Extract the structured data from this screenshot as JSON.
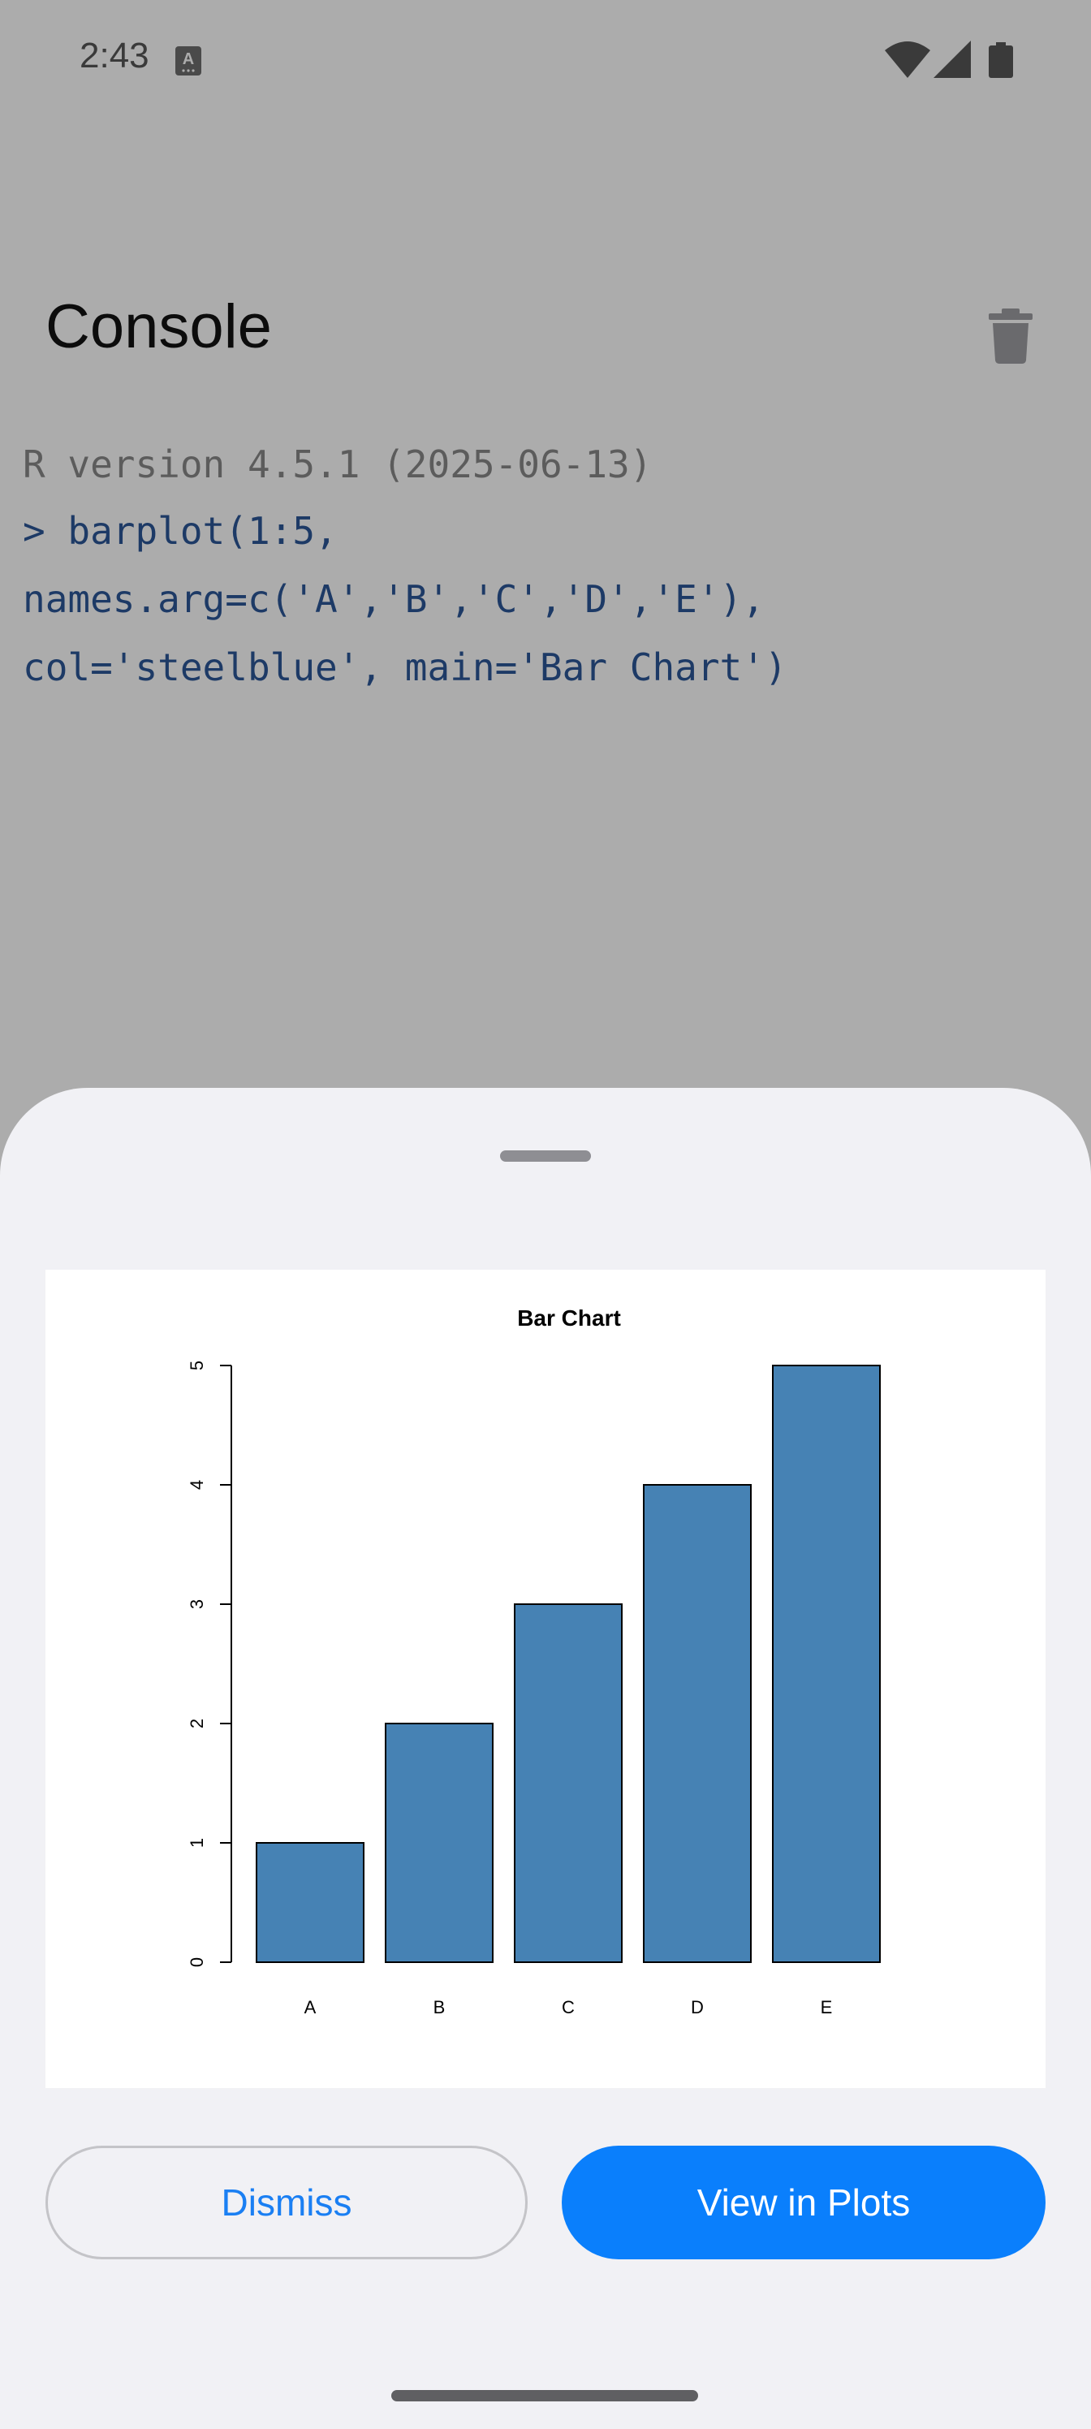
{
  "status_bar": {
    "time": "2:43",
    "icons": [
      "keyboard-badge-icon",
      "wifi-icon",
      "cell-signal-icon",
      "battery-icon"
    ]
  },
  "header": {
    "title": "Console",
    "clear_icon": "trash-icon"
  },
  "console": {
    "version_line": "R version 4.5.1 (2025-06-13)",
    "command_lines": [
      "> barplot(1:5,",
      "names.arg=c('A','B','C','D','E'),",
      "col='steelblue', main='Bar Chart')"
    ]
  },
  "sheet": {
    "dismiss_label": "Dismiss",
    "view_label": "View in Plots"
  },
  "colors": {
    "bar_fill": "#4682b4",
    "primary_button": "#0a7ffc",
    "dismiss_text": "#1a7ff3",
    "scrim": "#acacac",
    "sheet": "#f1f1f5"
  },
  "chart_data": {
    "type": "bar",
    "title": "Bar Chart",
    "categories": [
      "A",
      "B",
      "C",
      "D",
      "E"
    ],
    "values": [
      1,
      2,
      3,
      4,
      5
    ],
    "yticks": [
      "0",
      "1",
      "2",
      "3",
      "4",
      "5"
    ],
    "ylim": [
      0,
      5
    ],
    "xlabel": "",
    "ylabel": "",
    "grid": false
  }
}
